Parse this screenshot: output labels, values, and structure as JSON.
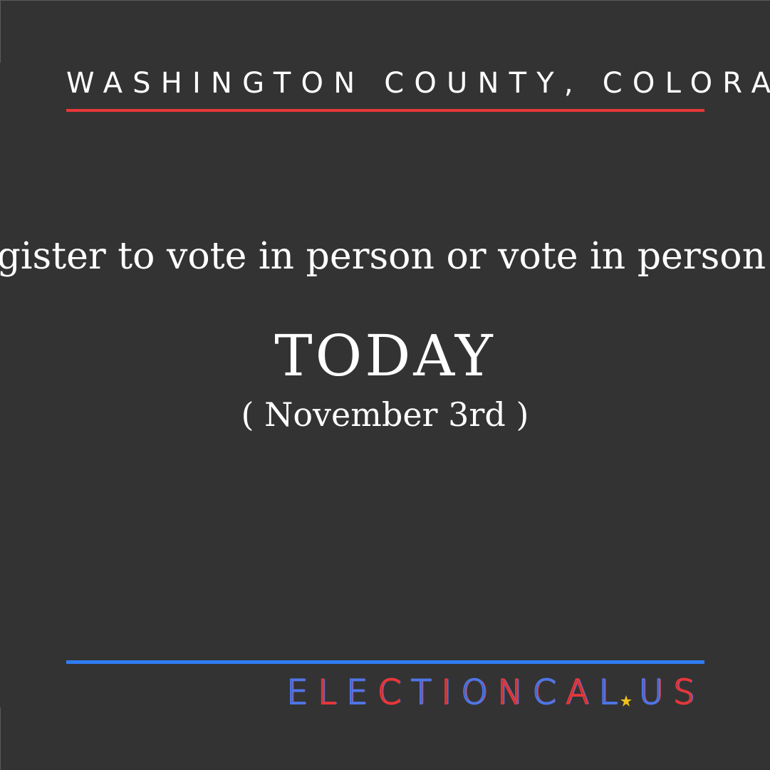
{
  "heading": {
    "text": "WASHINGTON COUNTY, COLORADO",
    "underline_color": "#e8373b"
  },
  "message": {
    "text": "Register to vote in person or vote in person by"
  },
  "deadline": {
    "label": "TODAY",
    "date": "( November 3rd )"
  },
  "footer": {
    "rule_color": "#2f7df4",
    "brand": {
      "part1": "ELECTIONCAL",
      "separator_icon": "star-icon",
      "part2": "US",
      "colors": {
        "red": "#e8373b",
        "blue": "#4f76e8",
        "star": "#f2c318"
      }
    }
  }
}
